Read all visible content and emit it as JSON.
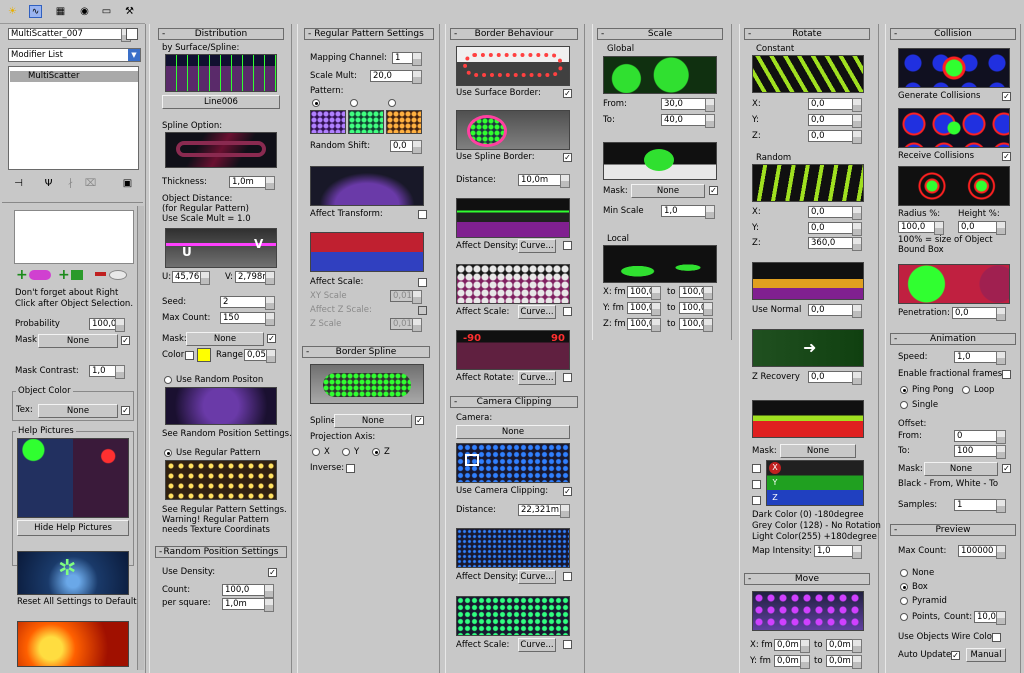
{
  "toolbar": {
    "icons": [
      "sun-icon",
      "curve-icon",
      "hierarchy-icon",
      "motion-icon",
      "display-icon",
      "hammer-icon"
    ]
  },
  "left": {
    "object_name": "MultiScatter_007",
    "modifier_list": "Modifier List",
    "stack_item": "MultiScatter",
    "right_click_hint": "Don't forget about Right Click after Object Selection.",
    "probability_label": "Probability",
    "probability_value": "100,0",
    "mask_label": "Mask",
    "mask_value": "None",
    "mask_contrast_label": "Mask Contrast:",
    "mask_contrast_value": "1,0",
    "object_color_title": "Object Color",
    "tex_label": "Tex:",
    "tex_value": "None",
    "help_pictures_title": "Help Pictures",
    "hide_help_label": "Hide Help Pictures",
    "reset_label": "Reset All Settings to Default"
  },
  "distribution": {
    "title": "Distribution",
    "by_surface": "by Surface/Spline:",
    "spline_name": "Line006",
    "spline_option": "Spline Option:",
    "thickness_label": "Thickness:",
    "thickness_value": "1,0m",
    "object_distance": "Object Distance:",
    "for_regular": "(for Regular Pattern)",
    "use_scale_mult": "Use Scale Mult = 1.0",
    "u_label": "U:",
    "u_value": "45,765",
    "v_label": "V:",
    "v_value": "2,798m",
    "seed_label": "Seed:",
    "seed_value": "2",
    "max_count_label": "Max Count:",
    "max_count_value": "150",
    "mask_label": "Mask:",
    "mask_value": "None",
    "color_label": "Color",
    "range_label": "Range",
    "range_value": "0,05",
    "use_random_pos": "Use Random Positon",
    "see_random": "See Random Position Settings.",
    "use_regular": "Use Regular Pattern",
    "see_regular_1": "See Regular Pattern Settings.",
    "see_regular_2": "Warning! Regular Pattern",
    "see_regular_3": "needs Texture Coordinats",
    "random_pos_title": "Random Position Settings",
    "use_density": "Use Density:",
    "count_label": "Count:",
    "count_value": "100,0",
    "per_square": "per square:",
    "per_square_value": "1,0m"
  },
  "regular": {
    "title": "Regular Pattern Settings",
    "mapping_channel": "Mapping Channel:",
    "mapping_value": "1",
    "scale_mult": "Scale Mult:",
    "scale_mult_value": "20,0",
    "pattern": "Pattern:",
    "random_shift": "Random Shift:",
    "random_shift_value": "0,0",
    "affect_transform": "Affect Transform:",
    "affect_scale": "Affect Scale:",
    "xy_scale": "XY Scale",
    "xy_scale_value": "0,01",
    "affect_z_scale": "Affect Z Scale:",
    "z_scale": "Z Scale",
    "z_scale_value": "0,01",
    "border_spline_title": "Border Spline",
    "spline_label": "Spline:",
    "spline_value": "None",
    "projection_axis": "Projection Axis:",
    "axis_x": "X",
    "axis_y": "Y",
    "axis_z": "Z",
    "inverse": "Inverse:"
  },
  "border": {
    "title": "Border Behaviour",
    "use_surface_border": "Use Surface Border:",
    "use_spline_border": "Use Spline Border:",
    "distance_label": "Distance:",
    "distance_value": "10,0m",
    "affect_density": "Affect Density:",
    "affect_scale": "Affect Scale:",
    "affect_rotate": "Affect Rotate:",
    "curve": "Curve...",
    "camera_clipping_title": "Camera Clipping",
    "camera_label": "Camera:",
    "camera_value": "None",
    "use_camera_clipping": "Use Camera Clipping:",
    "cam_distance_value": "22,321m"
  },
  "scale": {
    "title": "Scale",
    "global": "Global",
    "from_label": "From:",
    "from_value": "30,0",
    "to_label": "To:",
    "to_value": "40,0",
    "mask_label": "Mask:",
    "mask_value": "None",
    "min_scale_label": "Min Scale",
    "min_scale_value": "1,0",
    "local": "Local",
    "x_fm": "X: fm",
    "y_fm": "Y: fm",
    "z_fm": "Z: fm",
    "to": "to",
    "local_value": "100,0"
  },
  "rotate": {
    "title": "Rotate",
    "constant": "Constant",
    "x": "X:",
    "y": "Y:",
    "z": "Z:",
    "zero": "0,0",
    "random": "Random",
    "z_random_value": "360,0",
    "use_normal": "Use Normal",
    "z_recovery": "Z Recovery",
    "mask_label": "Mask:",
    "mask_value": "None",
    "dark_color": "Dark Color (0)    -180degree",
    "grey_color": "Grey Color (128)  - No Rotation",
    "light_color": "Light Color(255)  +180degree",
    "map_intensity": "Map Intensity:",
    "map_intensity_value": "1,0",
    "move_title": "Move",
    "move_x": "X: fm",
    "move_y": "Y: fm",
    "move_to": "to",
    "move_value": "0,0m",
    "badge_x": "X",
    "badge_y": "Y",
    "badge_z": "Z"
  },
  "collision": {
    "title": "Collision",
    "generate": "Generate Collisions",
    "receive": "Receive Collisions",
    "radius_label": "Radius %:",
    "height_label": "Height %:",
    "radius_value": "100,0",
    "height_value": "0,0",
    "size_note_1": "100% = size of Object",
    "size_note_2": "Bound Box",
    "penetration": "Penetration:",
    "penetration_value": "0,0",
    "animation_title": "Animation",
    "speed_label": "Speed:",
    "speed_value": "1,0",
    "fractional": "Enable fractional frames",
    "ping_pong": "Ping Pong",
    "loop": "Loop",
    "single": "Single",
    "offset": "Offset:",
    "from_label": "From:",
    "from_value": "0",
    "to_label": "To:",
    "to_value": "100",
    "mask_label": "Mask:",
    "mask_value": "None",
    "black_white": "Black - From,  White - To",
    "samples_label": "Samples:",
    "samples_value": "1",
    "preview_title": "Preview",
    "max_count": "Max Count:",
    "max_count_value": "100000",
    "none": "None",
    "box": "Box",
    "pyramid": "Pyramid",
    "points": "Points,",
    "count_label": "Count:",
    "count_value": "10,0",
    "wire_color": "Use Objects Wire Color",
    "auto_update": "Auto Update",
    "manual": "Manual"
  },
  "colors": {
    "bg": "#c8c8c8",
    "selection": "#a9a9a9",
    "yellow": "#ffff00",
    "accent_green": "#20c020"
  }
}
